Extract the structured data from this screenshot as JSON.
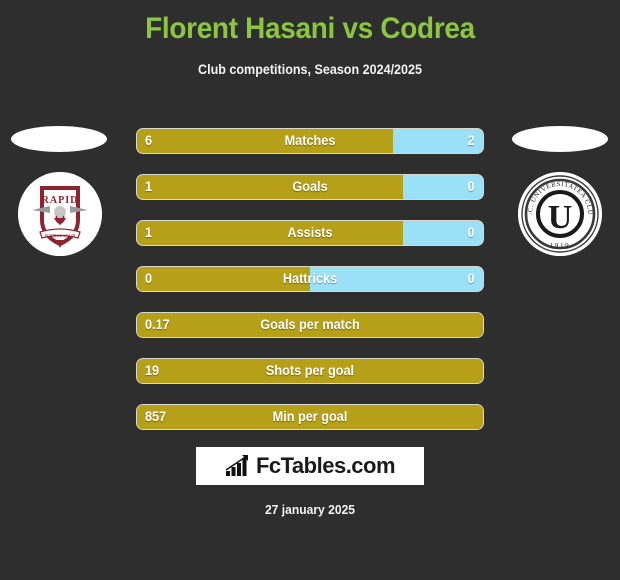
{
  "header": {
    "title": "Florent Hasani vs Codrea",
    "subtitle": "Club competitions, Season 2024/2025",
    "title_color": "#8cc63f",
    "background_color": "#2e2e2e"
  },
  "teams": {
    "home": {
      "crest_name": "rapid-bucuresti-crest",
      "crest_text_top": "RAPID",
      "crest_colors": [
        "#8e2430",
        "#ffffff",
        "#9a9a9a"
      ]
    },
    "away": {
      "crest_name": "universitatea-cluj-crest",
      "crest_text_ring": "F.C. UNIVERSITATEA CLUJ",
      "crest_text_center": "U",
      "crest_text_bottom": "1919",
      "crest_colors": [
        "#1a1a1a",
        "#ffffff"
      ]
    }
  },
  "legend": {
    "home_color": "#b5a017",
    "away_color": "#9ae0f7"
  },
  "chart_data": {
    "type": "bar",
    "title": "Florent Hasani vs Codrea",
    "subtitle": "Club competitions, Season 2024/2025",
    "xlabel": "",
    "ylabel": "",
    "grid": false,
    "legend_position": "none",
    "orientation": "horizontal-diverging",
    "categories": [
      "Matches",
      "Goals",
      "Assists",
      "Hattricks",
      "Goals per match",
      "Shots per goal",
      "Min per goal"
    ],
    "series": [
      {
        "name": "Florent Hasani",
        "color": "#b5a017",
        "values": [
          "6",
          "1",
          "1",
          "0",
          "0.17",
          "19",
          "857"
        ]
      },
      {
        "name": "Codrea",
        "color": "#9ae0f7",
        "values": [
          "2",
          "0",
          "0",
          "0",
          null,
          null,
          null
        ]
      }
    ],
    "rows": [
      {
        "label": "Matches",
        "left": "6",
        "right": "2",
        "fill_pct": 74,
        "two_sided": true
      },
      {
        "label": "Goals",
        "left": "1",
        "right": "0",
        "fill_pct": 77,
        "two_sided": true
      },
      {
        "label": "Assists",
        "left": "1",
        "right": "0",
        "fill_pct": 77,
        "two_sided": true
      },
      {
        "label": "Hattricks",
        "left": "0",
        "right": "0",
        "fill_pct": 50,
        "two_sided": true
      },
      {
        "label": "Goals per match",
        "left": "0.17",
        "right": null,
        "fill_pct": 100,
        "two_sided": false
      },
      {
        "label": "Shots per goal",
        "left": "19",
        "right": null,
        "fill_pct": 100,
        "two_sided": false
      },
      {
        "label": "Min per goal",
        "left": "857",
        "right": null,
        "fill_pct": 100,
        "two_sided": false
      }
    ]
  },
  "footer": {
    "logo_text": "FcTables.com",
    "logo_icon": "bar-chart-growth-icon",
    "date": "27 january 2025"
  }
}
